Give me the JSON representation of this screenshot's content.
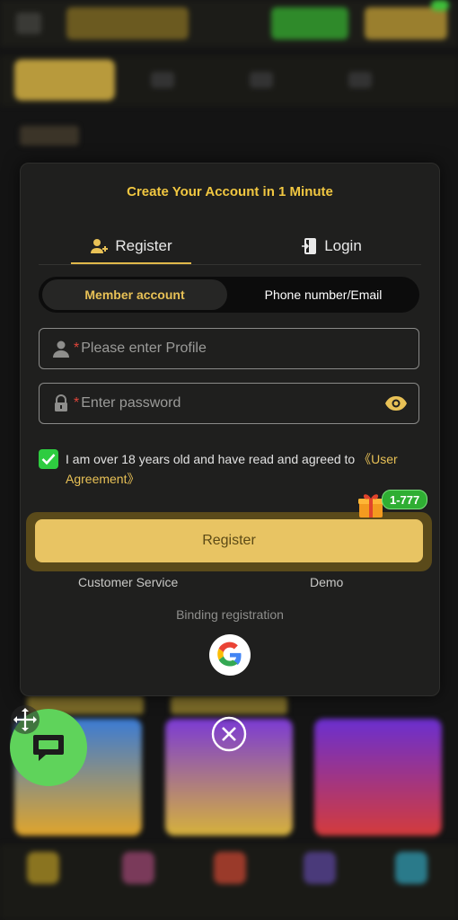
{
  "modal": {
    "title": "Create Your Account in 1 Minute",
    "tabs": {
      "register": "Register",
      "login": "Login"
    },
    "account_types": {
      "member": "Member account",
      "phone_email": "Phone number/Email"
    },
    "fields": {
      "profile": {
        "required_mark": "*",
        "placeholder": "Please enter Profile",
        "icon": "user-icon"
      },
      "password": {
        "required_mark": "*",
        "placeholder": "Enter password",
        "icon": "lock-icon"
      }
    },
    "agreement": {
      "checked": true,
      "text": "I am over 18 years old and have read and agreed to ",
      "link": "《User Agreement》"
    },
    "bonus_badge": "1-777",
    "register_button": "Register",
    "customer_service": "Customer Service",
    "demo": "Demo",
    "binding": "Binding registration"
  },
  "colors": {
    "accent": "#e8c463",
    "title": "#f1c741",
    "green": "#2ecc40",
    "modal_bg": "#1f1f1e"
  }
}
